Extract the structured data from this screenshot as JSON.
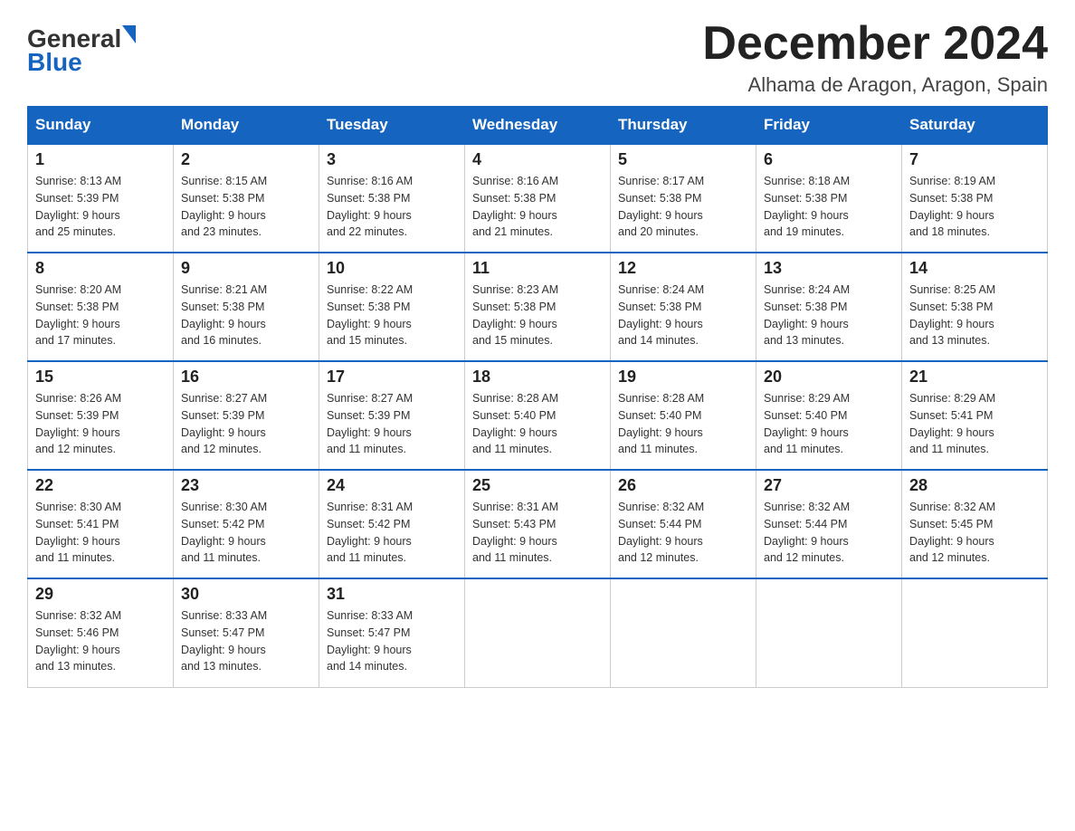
{
  "header": {
    "logo_general": "General",
    "logo_blue": "Blue",
    "title": "December 2024",
    "location": "Alhama de Aragon, Aragon, Spain"
  },
  "days_of_week": [
    "Sunday",
    "Monday",
    "Tuesday",
    "Wednesday",
    "Thursday",
    "Friday",
    "Saturday"
  ],
  "weeks": [
    [
      {
        "day": "1",
        "sunrise": "8:13 AM",
        "sunset": "5:39 PM",
        "daylight": "9 hours and 25 minutes."
      },
      {
        "day": "2",
        "sunrise": "8:15 AM",
        "sunset": "5:38 PM",
        "daylight": "9 hours and 23 minutes."
      },
      {
        "day": "3",
        "sunrise": "8:16 AM",
        "sunset": "5:38 PM",
        "daylight": "9 hours and 22 minutes."
      },
      {
        "day": "4",
        "sunrise": "8:16 AM",
        "sunset": "5:38 PM",
        "daylight": "9 hours and 21 minutes."
      },
      {
        "day": "5",
        "sunrise": "8:17 AM",
        "sunset": "5:38 PM",
        "daylight": "9 hours and 20 minutes."
      },
      {
        "day": "6",
        "sunrise": "8:18 AM",
        "sunset": "5:38 PM",
        "daylight": "9 hours and 19 minutes."
      },
      {
        "day": "7",
        "sunrise": "8:19 AM",
        "sunset": "5:38 PM",
        "daylight": "9 hours and 18 minutes."
      }
    ],
    [
      {
        "day": "8",
        "sunrise": "8:20 AM",
        "sunset": "5:38 PM",
        "daylight": "9 hours and 17 minutes."
      },
      {
        "day": "9",
        "sunrise": "8:21 AM",
        "sunset": "5:38 PM",
        "daylight": "9 hours and 16 minutes."
      },
      {
        "day": "10",
        "sunrise": "8:22 AM",
        "sunset": "5:38 PM",
        "daylight": "9 hours and 15 minutes."
      },
      {
        "day": "11",
        "sunrise": "8:23 AM",
        "sunset": "5:38 PM",
        "daylight": "9 hours and 15 minutes."
      },
      {
        "day": "12",
        "sunrise": "8:24 AM",
        "sunset": "5:38 PM",
        "daylight": "9 hours and 14 minutes."
      },
      {
        "day": "13",
        "sunrise": "8:24 AM",
        "sunset": "5:38 PM",
        "daylight": "9 hours and 13 minutes."
      },
      {
        "day": "14",
        "sunrise": "8:25 AM",
        "sunset": "5:38 PM",
        "daylight": "9 hours and 13 minutes."
      }
    ],
    [
      {
        "day": "15",
        "sunrise": "8:26 AM",
        "sunset": "5:39 PM",
        "daylight": "9 hours and 12 minutes."
      },
      {
        "day": "16",
        "sunrise": "8:27 AM",
        "sunset": "5:39 PM",
        "daylight": "9 hours and 12 minutes."
      },
      {
        "day": "17",
        "sunrise": "8:27 AM",
        "sunset": "5:39 PM",
        "daylight": "9 hours and 11 minutes."
      },
      {
        "day": "18",
        "sunrise": "8:28 AM",
        "sunset": "5:40 PM",
        "daylight": "9 hours and 11 minutes."
      },
      {
        "day": "19",
        "sunrise": "8:28 AM",
        "sunset": "5:40 PM",
        "daylight": "9 hours and 11 minutes."
      },
      {
        "day": "20",
        "sunrise": "8:29 AM",
        "sunset": "5:40 PM",
        "daylight": "9 hours and 11 minutes."
      },
      {
        "day": "21",
        "sunrise": "8:29 AM",
        "sunset": "5:41 PM",
        "daylight": "9 hours and 11 minutes."
      }
    ],
    [
      {
        "day": "22",
        "sunrise": "8:30 AM",
        "sunset": "5:41 PM",
        "daylight": "9 hours and 11 minutes."
      },
      {
        "day": "23",
        "sunrise": "8:30 AM",
        "sunset": "5:42 PM",
        "daylight": "9 hours and 11 minutes."
      },
      {
        "day": "24",
        "sunrise": "8:31 AM",
        "sunset": "5:42 PM",
        "daylight": "9 hours and 11 minutes."
      },
      {
        "day": "25",
        "sunrise": "8:31 AM",
        "sunset": "5:43 PM",
        "daylight": "9 hours and 11 minutes."
      },
      {
        "day": "26",
        "sunrise": "8:32 AM",
        "sunset": "5:44 PM",
        "daylight": "9 hours and 12 minutes."
      },
      {
        "day": "27",
        "sunrise": "8:32 AM",
        "sunset": "5:44 PM",
        "daylight": "9 hours and 12 minutes."
      },
      {
        "day": "28",
        "sunrise": "8:32 AM",
        "sunset": "5:45 PM",
        "daylight": "9 hours and 12 minutes."
      }
    ],
    [
      {
        "day": "29",
        "sunrise": "8:32 AM",
        "sunset": "5:46 PM",
        "daylight": "9 hours and 13 minutes."
      },
      {
        "day": "30",
        "sunrise": "8:33 AM",
        "sunset": "5:47 PM",
        "daylight": "9 hours and 13 minutes."
      },
      {
        "day": "31",
        "sunrise": "8:33 AM",
        "sunset": "5:47 PM",
        "daylight": "9 hours and 14 minutes."
      },
      null,
      null,
      null,
      null
    ]
  ],
  "labels": {
    "sunrise": "Sunrise:",
    "sunset": "Sunset:",
    "daylight": "Daylight:"
  }
}
